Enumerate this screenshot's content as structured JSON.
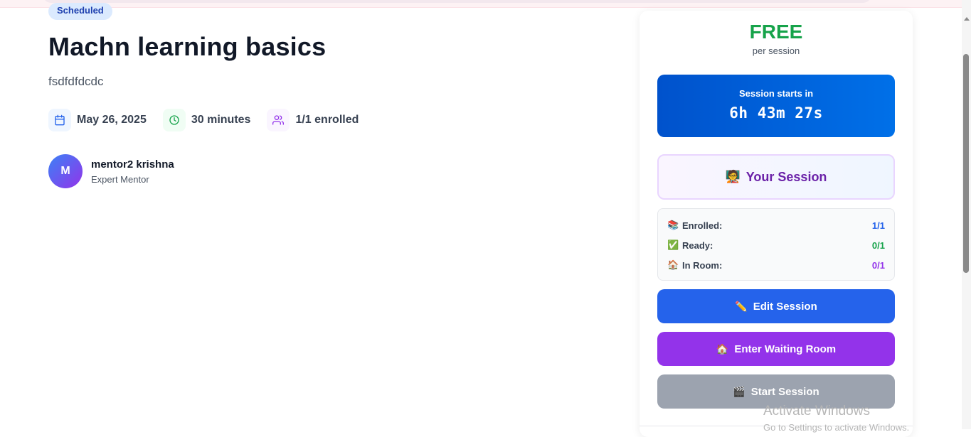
{
  "session": {
    "status_badge": "Scheduled",
    "title": "Machn learning basics",
    "description": "fsdfdfdcdc",
    "date": "May 26, 2025",
    "duration": "30 minutes",
    "enrolled": "1/1 enrolled"
  },
  "mentor": {
    "initial": "M",
    "name": "mentor2 krishna",
    "role": "Expert Mentor"
  },
  "card": {
    "price": "FREE",
    "price_sub": "per session",
    "countdown_label": "Session starts in",
    "countdown_value": "6h 43m 27s",
    "your_session_emoji": "🧑‍🏫",
    "your_session_label": "Your Session",
    "stats": [
      {
        "emoji": "📚",
        "label": "Enrolled:",
        "value": "1/1",
        "color": "#2563eb"
      },
      {
        "emoji": "✅",
        "label": "Ready:",
        "value": "0/1",
        "color": "#16a34a"
      },
      {
        "emoji": "🏠",
        "label": "In Room:",
        "value": "0/1",
        "color": "#9333ea"
      }
    ],
    "buttons": {
      "edit_emoji": "✏️",
      "edit_label": "Edit Session",
      "wait_emoji": "🏠",
      "wait_label": "Enter Waiting Room",
      "start_emoji": "🎬",
      "start_label": "Start Session"
    }
  },
  "watermark": {
    "title": "Activate Windows",
    "subtitle": "Go to Settings to activate Windows."
  },
  "colors": {
    "price": "#16a34a",
    "edit_button": "#2563eb",
    "wait_button": "#9333ea",
    "start_button_disabled": "#9ca3af",
    "countdown_gradient_start": "#0052cc",
    "countdown_gradient_end": "#0070e8"
  },
  "icons": {
    "date": "calendar-icon",
    "duration": "clock-icon",
    "enrolled": "users-icon"
  }
}
